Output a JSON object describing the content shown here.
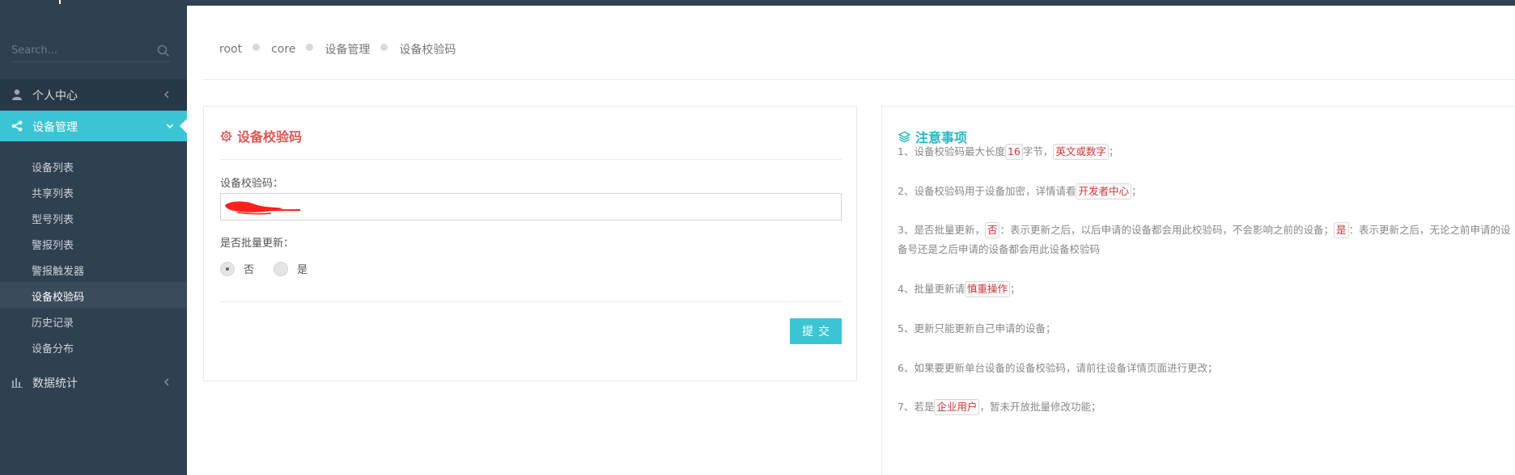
{
  "sidebar": {
    "search_placeholder": "Search...",
    "nav": {
      "personal": "个人中心",
      "device_mgmt": "设备管理",
      "stats": "数据统计"
    },
    "sub_items": [
      "设备列表",
      "共享列表",
      "型号列表",
      "警报列表",
      "警报触发器",
      "设备校验码",
      "历史记录",
      "设备分布"
    ]
  },
  "breadcrumb": [
    "root",
    "core",
    "设备管理",
    "设备校验码"
  ],
  "form": {
    "title": "设备校验码",
    "code_label": "设备校验码：",
    "code_value": "",
    "batch_label": "是否批量更新：",
    "option_no": "否",
    "option_yes": "是",
    "selected": "否",
    "submit": "提交"
  },
  "notes": {
    "title": "注意事项",
    "n1": {
      "a": "1、设备校验码最大长度",
      "h1": "16",
      "b": "字节，",
      "h2": "英文或数字",
      "c": "；"
    },
    "n2": {
      "a": "2、设备校验码用于设备加密，详情请看",
      "h1": "开发者中心",
      "b": "；"
    },
    "n3": {
      "a": "3、是否批量更新，",
      "h1": "否",
      "b": "：表示更新之后，以后申请的设备都会用此校验码，不会影响之前的设备；",
      "h2": "是",
      "c": "：表示更新之后，无论之前申请的设备号还是之后申请的设备都会用此设备校验码"
    },
    "n4": {
      "a": "4、批量更新请",
      "h1": "慎重操作",
      "b": "；"
    },
    "n5": {
      "a": "5、更新只能更新自己申请的设备；"
    },
    "n6": {
      "a": "6、如果要更新单台设备的设备校验码，请前往设备详情页面进行更改；"
    },
    "n7": {
      "a": "7、若是",
      "h1": "企业用户",
      "b": "，暂未开放批量修改功能；"
    }
  },
  "colors": {
    "sidebar_bg": "#2f4050",
    "accent": "#3bc5d4",
    "form_title": "#e05555",
    "highlight_text": "#d03838"
  }
}
